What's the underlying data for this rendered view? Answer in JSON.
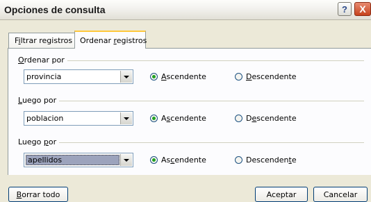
{
  "window": {
    "title": "Opciones de consulta"
  },
  "titlebar": {
    "help_glyph": "?",
    "close_glyph": "X"
  },
  "tabs": [
    {
      "pre": "F",
      "mn": "i",
      "post": "ltrar registros"
    },
    {
      "pre": "Ordenar ",
      "mn": "r",
      "post": "egistros"
    }
  ],
  "groups": [
    {
      "label": {
        "pre": "",
        "mn": "O",
        "post": "rdenar por"
      },
      "field_value": "provincia",
      "asc": {
        "pre": "",
        "mn": "A",
        "post": "scendente"
      },
      "desc": {
        "pre": "",
        "mn": "D",
        "post": "escendente"
      },
      "selected": "asc"
    },
    {
      "label": {
        "pre": "",
        "mn": "L",
        "post": "uego por"
      },
      "field_value": "poblacion",
      "asc": {
        "pre": "A",
        "mn": "s",
        "post": "cendente"
      },
      "desc": {
        "pre": "D",
        "mn": "e",
        "post": "scendente"
      },
      "selected": "asc"
    },
    {
      "label": {
        "pre": "Luego ",
        "mn": "p",
        "post": "or"
      },
      "field_value": "apellidos",
      "asc": {
        "pre": "As",
        "mn": "c",
        "post": "endente"
      },
      "desc": {
        "pre": "Descenden",
        "mn": "t",
        "post": "e"
      },
      "selected": "asc"
    }
  ],
  "buttons": {
    "clear": {
      "pre": "",
      "mn": "B",
      "post": "orrar todo"
    },
    "ok": "Aceptar",
    "cancel": "Cancelar"
  }
}
